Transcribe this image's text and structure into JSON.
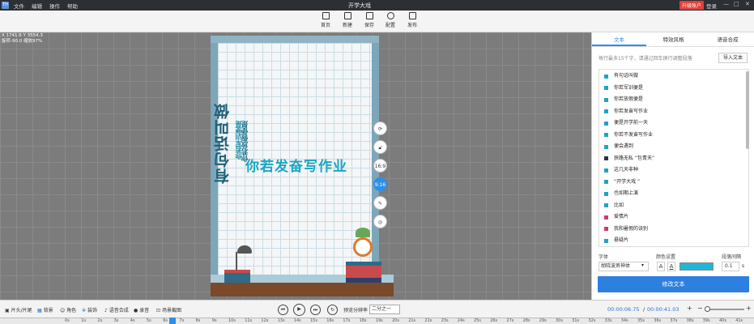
{
  "titlebar": {
    "logo": "TH",
    "menu": [
      "文件",
      "编辑",
      "操作",
      "帮助"
    ],
    "title": "开学大戏",
    "vip": "升级账户",
    "login": "登录",
    "controls": [
      "—",
      "□",
      "✕"
    ]
  },
  "toolbar": {
    "home": "首页",
    "new": "新建",
    "save": "保存",
    "config": "配置",
    "publish": "发布"
  },
  "canvas": {
    "coord_line1": "X 1741.6  Y 3554.3",
    "coord_line2": "旋转-90.0  缩放97%"
  },
  "poster": {
    "vertical_big": "有句话叫做",
    "vertical_small1": "你若军训便是",
    "vertical_small2": "你若放假便是",
    "main_text": "你若发奋写作业"
  },
  "side_controls": {
    "ratio_169": "16:9",
    "ratio_916": "9:16"
  },
  "panel": {
    "tabs": [
      "文本",
      "特效风格",
      "语音合成"
    ],
    "hint": "每行最多15个字，请通过回车换行调整段落",
    "import_label": "导入文本",
    "items": [
      {
        "text": "有句话叫做",
        "color": "#1fa3c7"
      },
      {
        "text": "你若军训便是",
        "color": "#1fa3c7"
      },
      {
        "text": "你若放假便是",
        "color": "#1fa3c7"
      },
      {
        "text": "你若发奋写作业",
        "color": "#1fa3c7"
      },
      {
        "text": "便是开学前一天",
        "color": "#1fa3c7"
      },
      {
        "text": "你若不发奋写作业",
        "color": "#1fa3c7"
      },
      {
        "text": "便会遇到",
        "color": "#1fa3c7"
      },
      {
        "text": "狭路无私 “包青天”",
        "color": "#333333"
      },
      {
        "text": "这几天非种",
        "color": "#1fa3c7"
      },
      {
        "text": "“开学大戏 ”",
        "color": "#1fa3c7"
      },
      {
        "text": "也如期上演",
        "color": "#1fa3c7"
      },
      {
        "text": "比如",
        "color": "#1fa3c7"
      },
      {
        "text": "爱情片",
        "color": "#d6337a"
      },
      {
        "text": "我和暑假的诀别",
        "color": "#d6337a"
      },
      {
        "text": "悬疑片",
        "color": "#1fa3c7"
      }
    ],
    "font_label": "字体",
    "color_label": "颜色设置",
    "spacing_label": "段落间隔",
    "font_value": "胡晓波男神体",
    "spacing_value": "0.1",
    "spacing_unit": "s",
    "apply_label": "修改文本",
    "text_color": "#1fb7d8"
  },
  "bottom": {
    "head_tail": "片头/片尾",
    "background": "背景",
    "role": "角色",
    "decoration": "装饰",
    "voice": "语音合成",
    "record": "录音",
    "scene": "场景截图",
    "ratio_label": "预览分辨率",
    "ratio_value": "二分之一",
    "time_current": "00:00:06.75",
    "time_sep": "/",
    "time_total": "00:00:41.03"
  },
  "ruler_ticks": [
    "0s",
    "1s",
    "2s",
    "3s",
    "4s",
    "5s",
    "6s",
    "7s",
    "8s",
    "9s",
    "10s",
    "11s",
    "12s",
    "13s",
    "14s",
    "15s",
    "16s",
    "17s",
    "18s",
    "19s",
    "20s",
    "21s",
    "22s",
    "23s",
    "24s",
    "25s",
    "26s",
    "27s",
    "28s",
    "29s",
    "30s",
    "31s",
    "32s",
    "33s",
    "34s",
    "35s",
    "36s",
    "37s",
    "38s",
    "39s",
    "40s",
    "41s"
  ]
}
